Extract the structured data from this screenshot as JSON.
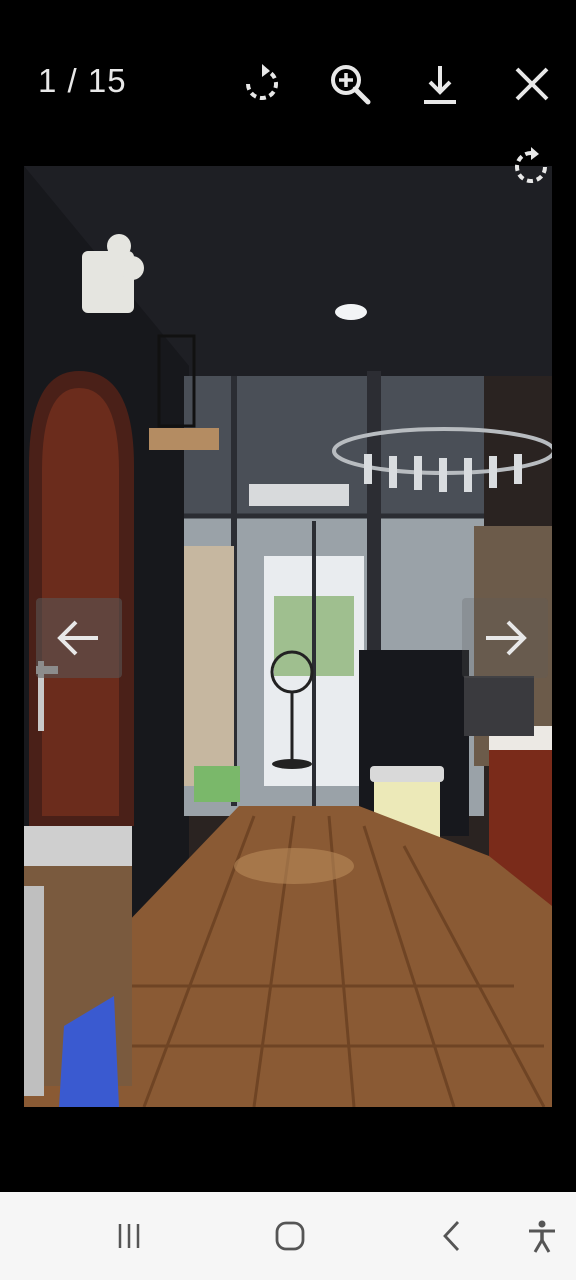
{
  "viewer": {
    "counter": "1 / 15",
    "toolbar": {
      "rotate_icon": "rotate-icon",
      "zoom_icon": "zoom-in-icon",
      "download_icon": "download-icon",
      "close_icon": "close-icon"
    },
    "photo": {
      "description_icon": "photo",
      "overlay_rotate_icon": "rotate-icon"
    },
    "nav": {
      "prev_icon": "arrow-left-icon",
      "next_icon": "arrow-right-icon"
    }
  },
  "system_nav": {
    "recent_icon": "recent-apps-icon",
    "home_icon": "home-icon",
    "back_icon": "back-icon",
    "accessibility_icon": "accessibility-icon"
  },
  "colors": {
    "background": "#000000",
    "toolbar_icon": "#e8e8e8",
    "navbar_bg": "#f6f6f6",
    "navbar_icon": "#555555"
  }
}
